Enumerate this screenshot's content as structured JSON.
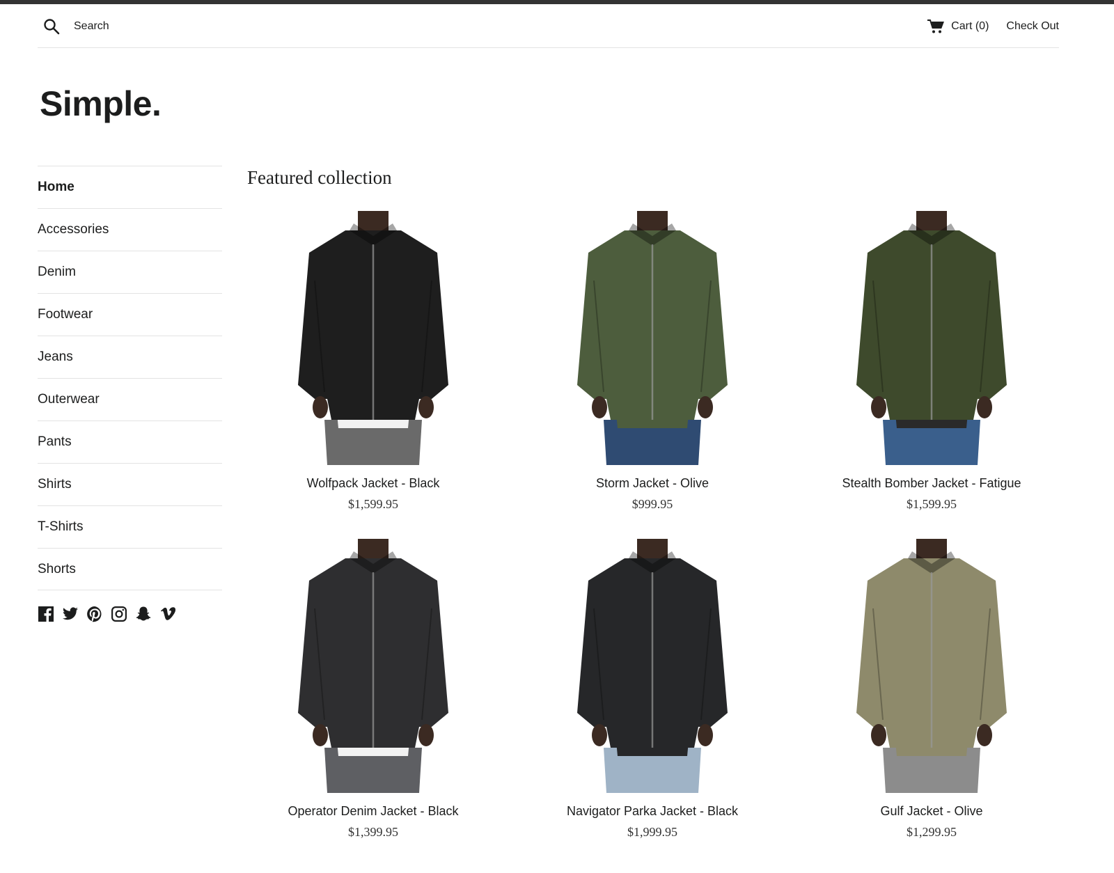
{
  "header": {
    "search_label": "Search",
    "cart_label": "Cart (0)",
    "checkout_label": "Check Out"
  },
  "logo": "Simple.",
  "sidebar": {
    "items": [
      {
        "label": "Home",
        "active": true
      },
      {
        "label": "Accessories"
      },
      {
        "label": "Denim"
      },
      {
        "label": "Footwear"
      },
      {
        "label": "Jeans"
      },
      {
        "label": "Outerwear"
      },
      {
        "label": "Pants"
      },
      {
        "label": "Shirts"
      },
      {
        "label": "T-Shirts"
      },
      {
        "label": "Shorts"
      }
    ],
    "social": [
      "facebook-icon",
      "twitter-icon",
      "pinterest-icon",
      "instagram-icon",
      "snapchat-icon",
      "vimeo-icon"
    ]
  },
  "collection": {
    "title": "Featured collection",
    "products": [
      {
        "name": "Wolfpack Jacket - Black",
        "price": "$1,599.95",
        "jacket_color": "#1e1e1e",
        "bottom_color": "#6a6a6a",
        "shirt_color": "#f2f2f2"
      },
      {
        "name": "Storm Jacket - Olive",
        "price": "$999.95",
        "jacket_color": "#4d5d3d",
        "bottom_color": "#2f4b72",
        "shirt_color": "#4d5d3d"
      },
      {
        "name": "Stealth Bomber Jacket - Fatigue",
        "price": "$1,599.95",
        "jacket_color": "#3e4a2c",
        "bottom_color": "#3a5f8c",
        "shirt_color": "#2a2a2a"
      },
      {
        "name": "Operator Denim Jacket - Black",
        "price": "$1,399.95",
        "jacket_color": "#2e2e30",
        "bottom_color": "#5e5f63",
        "shirt_color": "#f2f2f2"
      },
      {
        "name": "Navigator Parka Jacket - Black",
        "price": "$1,999.95",
        "jacket_color": "#262729",
        "bottom_color": "#9fb3c6",
        "shirt_color": "#262729"
      },
      {
        "name": "Gulf Jacket - Olive",
        "price": "$1,299.95",
        "jacket_color": "#8e8a6b",
        "bottom_color": "#8c8c8c",
        "shirt_color": "#8e8a6b"
      }
    ]
  }
}
